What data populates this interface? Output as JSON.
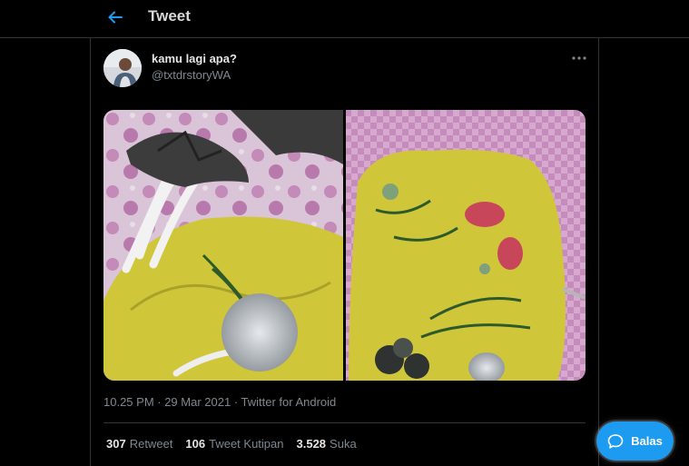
{
  "header": {
    "title": "Tweet"
  },
  "tweet": {
    "display_name": "kamu lagi apa?",
    "handle": "@txtdrstoryWA",
    "timestamp": "10.25 PM · 29 Mar 2021 · Twitter for Android",
    "stats": {
      "retweets_count": "307",
      "retweets_label": "Retweet",
      "quotes_count": "106",
      "quotes_label": "Tweet Kutipan",
      "likes_count": "3.528",
      "likes_label": "Suka"
    }
  },
  "reply_button": {
    "label": "Balas"
  },
  "colors": {
    "accent": "#1d9bf0",
    "background": "#000000",
    "divider": "#2f3336"
  },
  "icons": {
    "back": "arrow-left-icon",
    "more": "more-horizontal-icon",
    "reply": "chat-bubble-icon"
  }
}
